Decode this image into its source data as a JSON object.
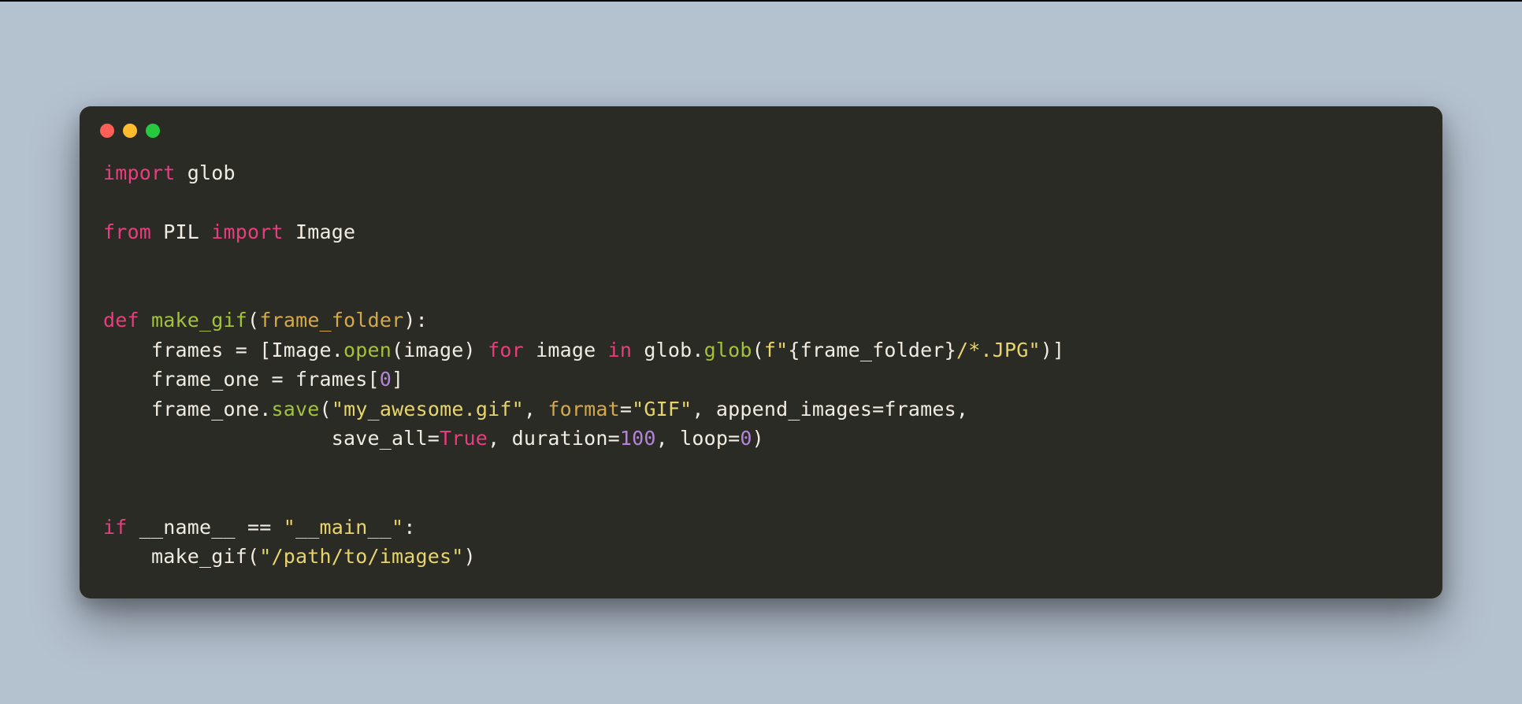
{
  "colors": {
    "bg_page": "#b4c1cf",
    "bg_window": "#2b2b26",
    "btn_close": "#ff5f56",
    "btn_min": "#ffbd2e",
    "btn_max": "#27c93f",
    "syntax_keyword": "#e83e7f",
    "syntax_function": "#a2c23a",
    "syntax_string": "#e7d56b",
    "syntax_number": "#b385d6",
    "syntax_param": "#d4a94a",
    "syntax_default": "#f0ece2"
  },
  "window": {
    "buttons": [
      "close",
      "minimize",
      "maximize"
    ]
  },
  "code": {
    "tokens": [
      [
        {
          "t": "import",
          "c": "kw"
        },
        {
          "t": " glob",
          "c": "txt"
        }
      ],
      [],
      [
        {
          "t": "from",
          "c": "kw"
        },
        {
          "t": " PIL ",
          "c": "txt"
        },
        {
          "t": "import",
          "c": "kw"
        },
        {
          "t": " Image",
          "c": "txt"
        }
      ],
      [],
      [],
      [
        {
          "t": "def",
          "c": "kw"
        },
        {
          "t": " ",
          "c": "txt"
        },
        {
          "t": "make_gif",
          "c": "fn"
        },
        {
          "t": "(",
          "c": "txt"
        },
        {
          "t": "frame_folder",
          "c": "par"
        },
        {
          "t": "):",
          "c": "txt"
        }
      ],
      [
        {
          "t": "    frames = [Image.",
          "c": "txt"
        },
        {
          "t": "open",
          "c": "fn"
        },
        {
          "t": "(image) ",
          "c": "txt"
        },
        {
          "t": "for",
          "c": "kw"
        },
        {
          "t": " image ",
          "c": "txt"
        },
        {
          "t": "in",
          "c": "kw"
        },
        {
          "t": " glob.",
          "c": "txt"
        },
        {
          "t": "glob",
          "c": "fn"
        },
        {
          "t": "(",
          "c": "txt"
        },
        {
          "t": "f\"",
          "c": "str"
        },
        {
          "t": "{frame_folder}",
          "c": "txt"
        },
        {
          "t": "/*.JPG\"",
          "c": "str"
        },
        {
          "t": ")]",
          "c": "txt"
        }
      ],
      [
        {
          "t": "    frame_one = frames[",
          "c": "txt"
        },
        {
          "t": "0",
          "c": "num"
        },
        {
          "t": "]",
          "c": "txt"
        }
      ],
      [
        {
          "t": "    frame_one.",
          "c": "txt"
        },
        {
          "t": "save",
          "c": "fn"
        },
        {
          "t": "(",
          "c": "txt"
        },
        {
          "t": "\"my_awesome.gif\"",
          "c": "str"
        },
        {
          "t": ", ",
          "c": "txt"
        },
        {
          "t": "format",
          "c": "par"
        },
        {
          "t": "=",
          "c": "txt"
        },
        {
          "t": "\"GIF\"",
          "c": "str"
        },
        {
          "t": ", append_images=frames,",
          "c": "txt"
        }
      ],
      [
        {
          "t": "                   save_all=",
          "c": "txt"
        },
        {
          "t": "True",
          "c": "tf"
        },
        {
          "t": ", duration=",
          "c": "txt"
        },
        {
          "t": "100",
          "c": "num"
        },
        {
          "t": ", loop=",
          "c": "txt"
        },
        {
          "t": "0",
          "c": "num"
        },
        {
          "t": ")",
          "c": "txt"
        }
      ],
      [],
      [],
      [
        {
          "t": "if",
          "c": "kw"
        },
        {
          "t": " __name__ == ",
          "c": "txt"
        },
        {
          "t": "\"__main__\"",
          "c": "str"
        },
        {
          "t": ":",
          "c": "txt"
        }
      ],
      [
        {
          "t": "    make_gif(",
          "c": "txt"
        },
        {
          "t": "\"/path/to/images\"",
          "c": "str"
        },
        {
          "t": ")",
          "c": "txt"
        }
      ]
    ],
    "plain": "import glob\n\nfrom PIL import Image\n\n\ndef make_gif(frame_folder):\n    frames = [Image.open(image) for image in glob.glob(f\"{frame_folder}/*.JPG\")]\n    frame_one = frames[0]\n    frame_one.save(\"my_awesome.gif\", format=\"GIF\", append_images=frames,\n                   save_all=True, duration=100, loop=0)\n\n\nif __name__ == \"__main__\":\n    make_gif(\"/path/to/images\")"
  }
}
